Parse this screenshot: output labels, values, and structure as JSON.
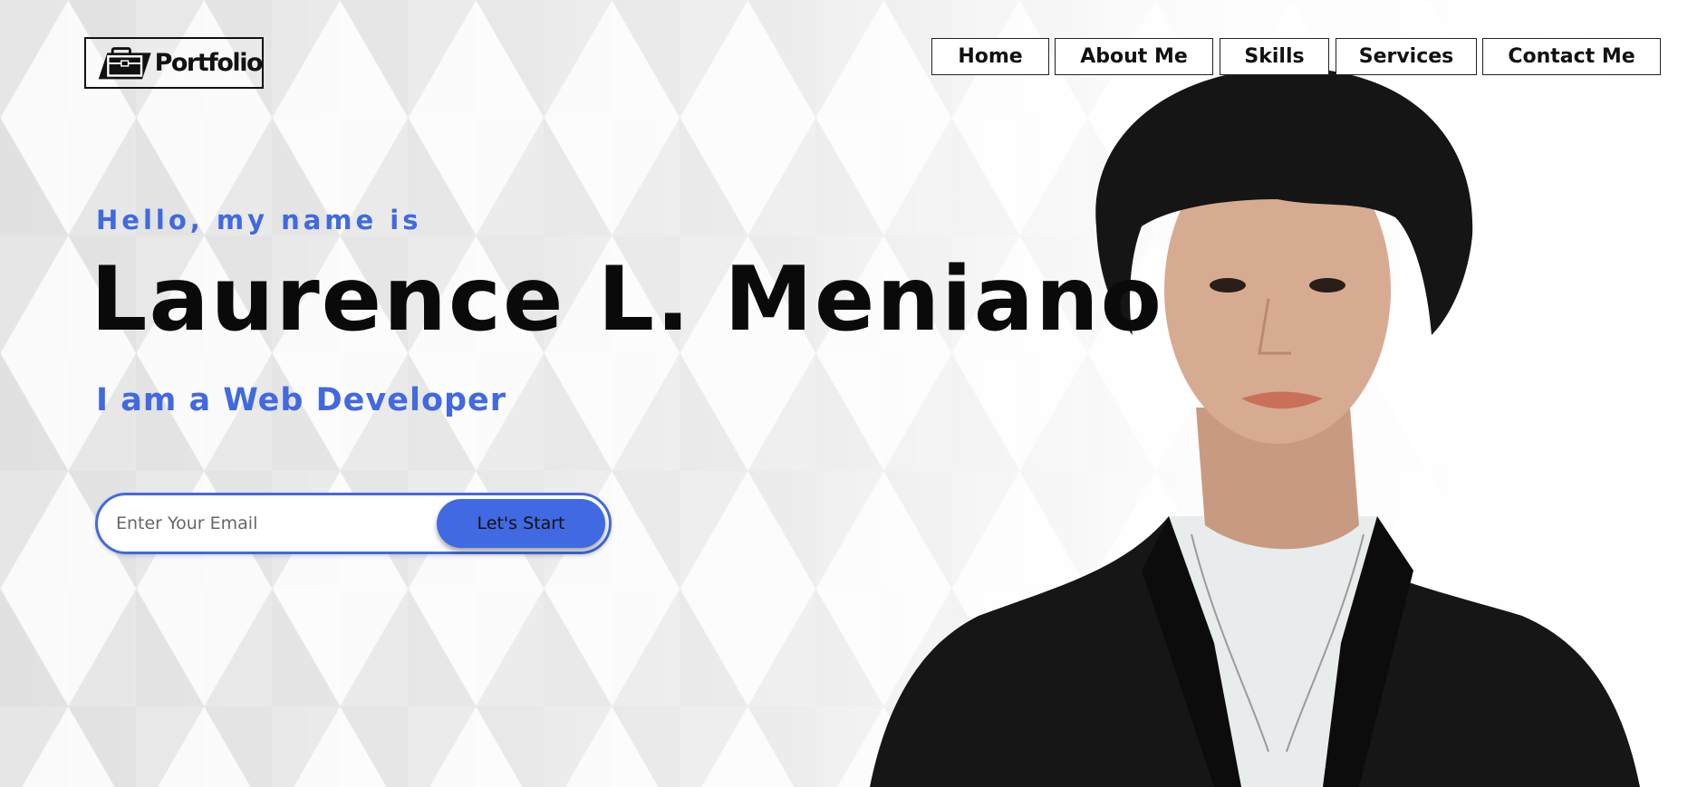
{
  "header": {
    "logo_text": "Portfolio",
    "logo_icon": "briefcase-icon"
  },
  "nav": {
    "items": [
      {
        "label": "Home"
      },
      {
        "label": "About Me"
      },
      {
        "label": "Skills"
      },
      {
        "label": "Services"
      },
      {
        "label": "Contact Me"
      }
    ]
  },
  "hero": {
    "greeting": "Hello, my name is",
    "name": "Laurence L. Meniano",
    "role": "I am a Web Developer"
  },
  "form": {
    "email_placeholder": "Enter Your Email",
    "email_value": "",
    "button_label": "Let's Start"
  },
  "colors": {
    "accent": "#4169e1",
    "text": "#0a0a0a",
    "background": "#f2f2f2"
  }
}
